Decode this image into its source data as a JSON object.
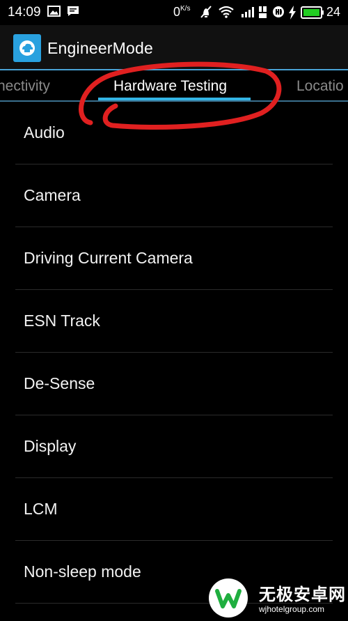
{
  "status_bar": {
    "time": "14:09",
    "net_speed": "0",
    "net_speed_unit": "K/s",
    "battery_level": "24",
    "icons": [
      "image-icon",
      "message-icon",
      "mute-icon",
      "wifi-icon",
      "signal-icon",
      "4g-lte-icon",
      "hd-icon",
      "charging-icon",
      "battery-icon"
    ],
    "battery_color": "#22cc22"
  },
  "app": {
    "title": "EngineerMode",
    "icon": "engineermode-app-icon",
    "accent_color": "#33b5e5"
  },
  "tabs": [
    {
      "label": "nectivity",
      "active": false
    },
    {
      "label": "Hardware Testing",
      "active": true
    },
    {
      "label": "Locatio",
      "active": false
    }
  ],
  "list": {
    "items": [
      "Audio",
      "Camera",
      "Driving Current Camera",
      "ESN Track",
      "De-Sense",
      "Display",
      "LCM",
      "Non-sleep mode"
    ]
  },
  "annotation": {
    "type": "hand-drawn-circle",
    "color": "#e02020"
  },
  "watermark": {
    "title": "无极安卓网",
    "url": "wjhotelgroup.com"
  }
}
